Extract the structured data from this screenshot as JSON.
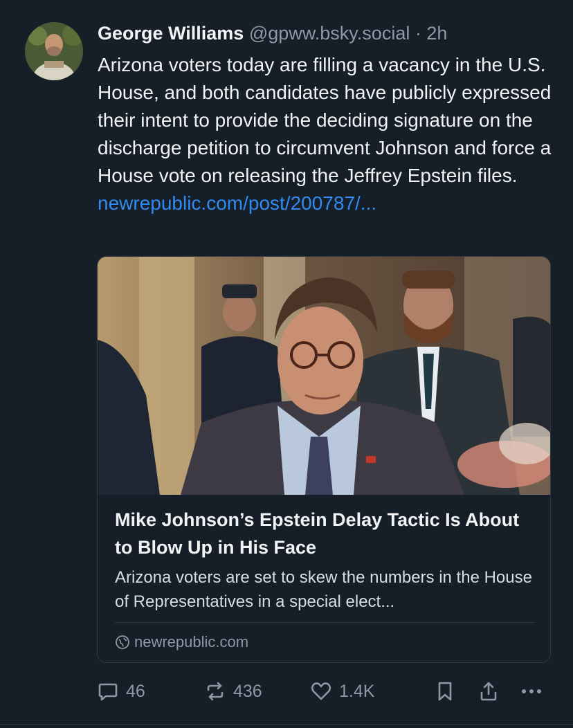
{
  "post": {
    "author_name": "George Williams",
    "handle": "@gpww.bsky.social",
    "separator": "·",
    "time": "2h",
    "text": "Arizona voters today are filling a vacancy in the U.S. House, and both candidates have publicly expressed their intent to provide the deciding signature on the discharge petition to circumvent Johnson and force a House vote on releasing the Jeffrey Epstein files.",
    "link": "newrepublic.com/post/200787/..."
  },
  "card": {
    "title": "Mike Johnson’s Epstein Delay Tactic Is About to Blow Up in His Face",
    "description": "Arizona voters are set to skew the numbers in the House of Representatives in a special elect...",
    "domain": "newrepublic.com",
    "domain_icon": "globe-icon"
  },
  "actions": {
    "replies": "46",
    "reposts": "436",
    "likes": "1.4K"
  },
  "colors": {
    "background": "#161e27",
    "link": "#2f8bf2",
    "muted": "#8d99a6"
  }
}
